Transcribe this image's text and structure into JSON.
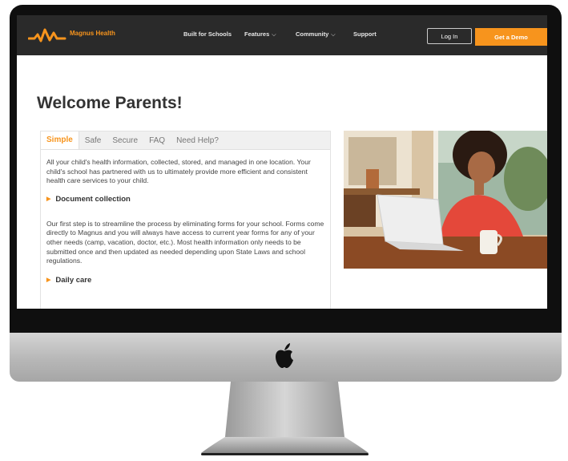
{
  "site": {
    "logo_text": "Magnus Health",
    "nav": {
      "built_for_schools": "Built for Schools",
      "features": "Features",
      "community": "Community",
      "support": "Support",
      "login": "Log In",
      "get_demo": "Get a Demo"
    },
    "title": "Welcome Parents!",
    "tabs": [
      "Simple",
      "Safe",
      "Secure",
      "FAQ",
      "Need Help?"
    ],
    "active_tab": "Simple",
    "intro": "All your child's health information, collected, stored, and managed in one location. Your child's school has partnered with us to ultimately provide more efficient and consistent health care services to your child.",
    "sections": [
      {
        "heading": "Document collection",
        "text": "Our first step is to streamline the process by eliminating forms for your school. Forms come directly to Magnus and you will always have access to current year forms for any of your other needs (camp, vacation, doctor, etc.). Most health information only needs to be submitted once and then updated as needed depending upon State Laws and school regulations."
      },
      {
        "heading": "Daily care"
      }
    ]
  },
  "colors": {
    "accent": "#f7941d",
    "nav_bg": "#2a2a2a",
    "bezel": "#0f0f0f",
    "chin": "#c0c0c0"
  },
  "icons": [
    "magnus-logo-icon",
    "chevron-down-icon",
    "triangle-right-icon",
    "apple-logo-icon"
  ]
}
